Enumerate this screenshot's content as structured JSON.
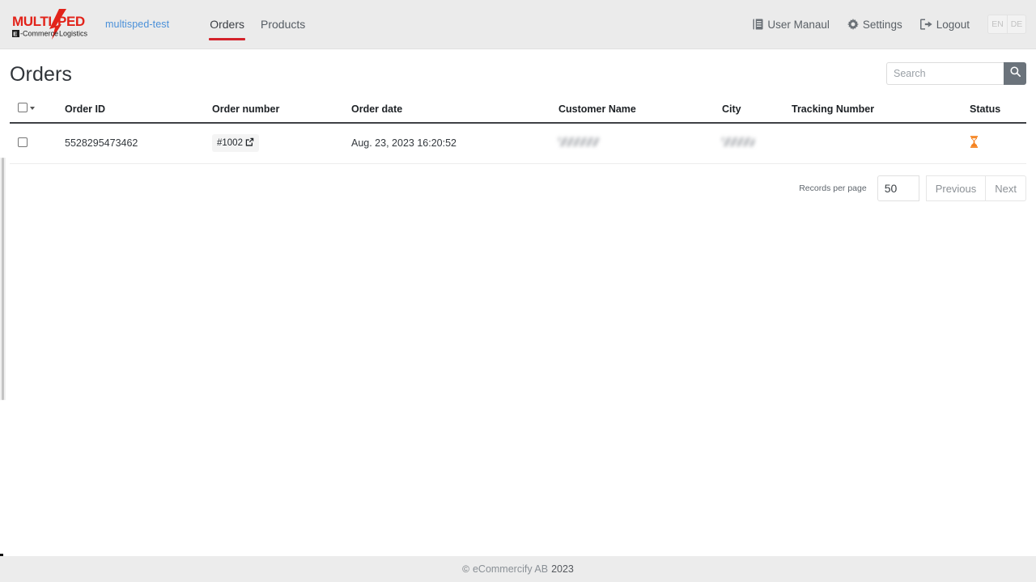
{
  "brand": {
    "logo_text_top": "MULTISPED",
    "logo_text_bottom_a": "E-Commerce",
    "logo_text_bottom_b": "Logistics",
    "logo_color": "#e2231a"
  },
  "topbar": {
    "shop_link": "multisped-test",
    "tabs": [
      {
        "label": "Orders",
        "active": true
      },
      {
        "label": "Products",
        "active": false
      }
    ],
    "right_items": [
      {
        "label": "User Manaul",
        "icon": "book-icon"
      },
      {
        "label": "Settings",
        "icon": "gear-icon"
      },
      {
        "label": "Logout",
        "icon": "logout-icon"
      }
    ],
    "languages": [
      {
        "code": "EN",
        "active": false
      },
      {
        "code": "DE",
        "active": false
      }
    ]
  },
  "page": {
    "title": "Orders"
  },
  "search": {
    "placeholder": "Search",
    "value": "",
    "icon": "search-icon",
    "button_color": "#6b737b"
  },
  "table": {
    "columns": [
      "Order ID",
      "Order number",
      "Order date",
      "Customer Name",
      "City",
      "Tracking Number",
      "Status"
    ],
    "rows": [
      {
        "selected": false,
        "order_id": "5528295473462",
        "order_number": "#1002",
        "order_number_icon": "external-link-icon",
        "order_date": "Aug. 23, 2023 16:20:52",
        "customer_name": "",
        "city": "",
        "tracking_number": "",
        "status_icon": "hourglass-icon",
        "status_color": "#f5821f"
      }
    ]
  },
  "pagination": {
    "records_label": "Records per page",
    "records_value": "50",
    "previous_label": "Previous",
    "next_label": "Next"
  },
  "footer": {
    "copyright_symbol": "©",
    "company": "eCommercify AB",
    "year": "2023"
  }
}
